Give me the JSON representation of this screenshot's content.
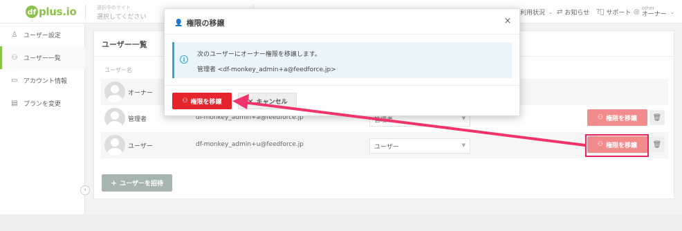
{
  "header": {
    "logo_mark": "df",
    "logo_text": "plus.io",
    "site_select_label": "選択中のサイト",
    "site_select_value": "選択してください",
    "usage_label": "利用状況",
    "news_label": "お知らせ",
    "support_label": "サポート",
    "user_small": "other",
    "user_role": "オーナー"
  },
  "sidebar": {
    "items": [
      {
        "label": "ユーザー設定",
        "icon": "user-icon"
      },
      {
        "label": "ユーザー一覧",
        "icon": "users-icon"
      },
      {
        "label": "アカウント情報",
        "icon": "id-card-icon"
      },
      {
        "label": "プランを変更",
        "icon": "credit-card-icon"
      }
    ],
    "collapse_glyph": "‹"
  },
  "main": {
    "title": "ユーザー一覧",
    "column_header": "ユーザー名",
    "rows": [
      {
        "name": "オーナー",
        "email": "",
        "role": "",
        "shaded": true
      },
      {
        "name": "管理者",
        "email": "df-monkey_admin+a@feedforce.jp",
        "role": "管理者",
        "shaded": false
      },
      {
        "name": "ユーザー",
        "email": "df-monkey_admin+u@feedforce.jp",
        "role": "ユーザー",
        "shaded": true
      }
    ],
    "transfer_label": "権限を移譲",
    "invite_label": "ユーザーを招待"
  },
  "modal": {
    "title": "権限の移譲",
    "info_line1": "次のユーザーにオーナー権限を移譲します。",
    "info_line2": "管理者 <df-monkey_admin+a@feedforce.jp>",
    "confirm_label": "権限を移譲",
    "cancel_label": "キャンセル"
  },
  "colors": {
    "brand": "#8bc34a",
    "danger": "#e5242c",
    "danger_light": "#f28b8b",
    "info": "#2aa7d8",
    "annotation": "#e5245e"
  }
}
